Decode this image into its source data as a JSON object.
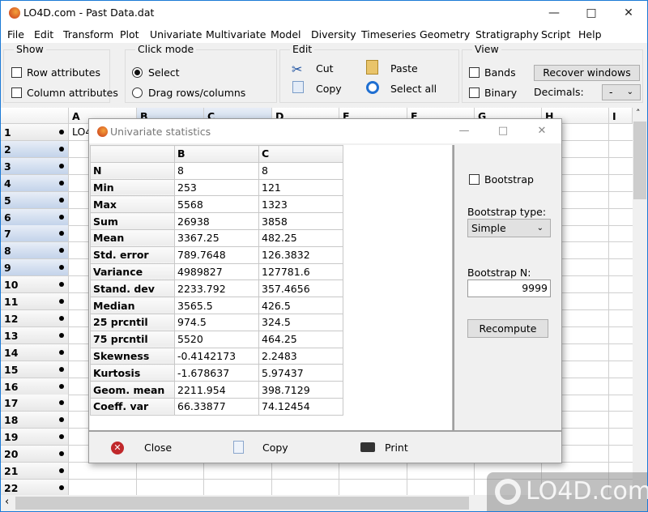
{
  "window": {
    "title": "LO4D.com - Past Data.dat",
    "controls": [
      "minimize",
      "maximize",
      "close"
    ]
  },
  "menu": [
    "File",
    "Edit",
    "Transform",
    "Plot",
    "Univariate",
    "Multivariate",
    "Model",
    "Diversity",
    "Timeseries",
    "Geometry",
    "Stratigraphy",
    "Script",
    "Help"
  ],
  "toolbar": {
    "show": {
      "title": "Show",
      "row_attributes": "Row attributes",
      "column_attributes": "Column attributes",
      "row_checked": false,
      "col_checked": false
    },
    "click_mode": {
      "title": "Click mode",
      "select": "Select",
      "drag": "Drag rows/columns",
      "selected": "Select"
    },
    "edit": {
      "title": "Edit",
      "cut": "Cut",
      "copy": "Copy",
      "paste": "Paste",
      "select_all": "Select all"
    },
    "view": {
      "title": "View",
      "bands": "Bands",
      "binary": "Binary",
      "recover": "Recover windows",
      "decimals_label": "Decimals:",
      "decimals_value": "-"
    }
  },
  "grid": {
    "columns": [
      "A",
      "B",
      "C",
      "D",
      "E",
      "F",
      "G",
      "H",
      "I"
    ],
    "selected_columns": [
      "B",
      "C"
    ],
    "rows": [
      "1",
      "2",
      "3",
      "4",
      "5",
      "6",
      "7",
      "8",
      "9",
      "10",
      "11",
      "12",
      "13",
      "14",
      "15",
      "16",
      "17",
      "18",
      "19",
      "20",
      "21",
      "22"
    ],
    "selected_rows": [
      "2",
      "3",
      "4",
      "5",
      "6",
      "7",
      "8",
      "9"
    ],
    "cell_a1": "LO4"
  },
  "dialog": {
    "title": "Univariate statistics",
    "table": {
      "headers": [
        "",
        "B",
        "C"
      ],
      "rows": [
        [
          "N",
          "8",
          "8"
        ],
        [
          "Min",
          "253",
          "121"
        ],
        [
          "Max",
          "5568",
          "1323"
        ],
        [
          "Sum",
          "26938",
          "3858"
        ],
        [
          "Mean",
          "3367.25",
          "482.25"
        ],
        [
          "Std. error",
          "789.7648",
          "126.3832"
        ],
        [
          "Variance",
          "4989827",
          "127781.6"
        ],
        [
          "Stand. dev",
          "2233.792",
          "357.4656"
        ],
        [
          "Median",
          "3565.5",
          "426.5"
        ],
        [
          "25 prcntil",
          "974.5",
          "324.5"
        ],
        [
          "75 prcntil",
          "5520",
          "464.25"
        ],
        [
          "Skewness",
          "-0.4142173",
          "2.2483"
        ],
        [
          "Kurtosis",
          "-1.678637",
          "5.97437"
        ],
        [
          "Geom. mean",
          "2211.954",
          "398.7129"
        ],
        [
          "Coeff. var",
          "66.33877",
          "74.12454"
        ]
      ]
    },
    "bootstrap": {
      "checkbox_label": "Bootstrap",
      "checked": false,
      "type_label": "Bootstrap type:",
      "type_value": "Simple",
      "n_label": "Bootstrap N:",
      "n_value": "9999",
      "recompute": "Recompute"
    },
    "buttons": {
      "close": "Close",
      "copy": "Copy",
      "print": "Print"
    }
  },
  "watermark": "LO4D.com"
}
